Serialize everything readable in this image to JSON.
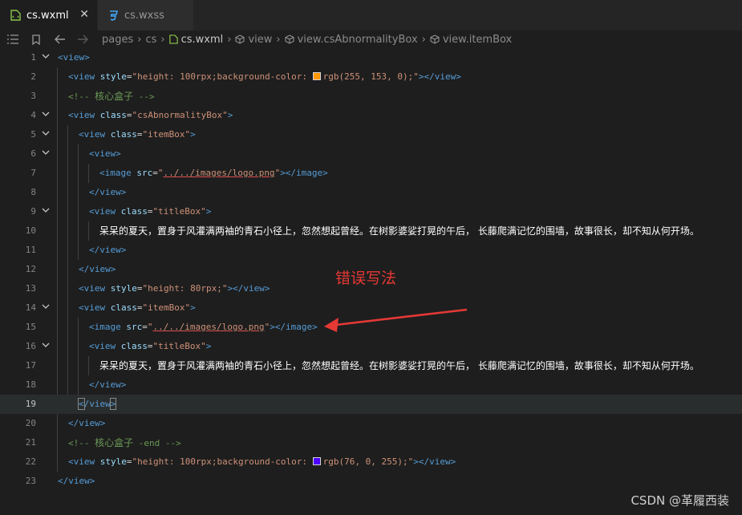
{
  "tabs": [
    {
      "label": "cs.wxml",
      "icon": "wxml-file-icon",
      "active": true
    },
    {
      "label": "cs.wxss",
      "icon": "css-file-icon",
      "active": false
    }
  ],
  "breadcrumb": {
    "items": [
      "pages",
      "cs",
      "cs.wxml",
      "view",
      "view.csAbnormalityBox",
      "view.itemBox"
    ]
  },
  "close_glyph": "✕",
  "editor": {
    "active_line": 19,
    "lines": [
      {
        "n": "1",
        "parts": [
          [
            "tag",
            "<view>"
          ]
        ]
      },
      {
        "n": "2",
        "parts": [
          [
            "tag",
            "<view "
          ],
          [
            "attr",
            "style"
          ],
          [
            "pun",
            "="
          ],
          [
            "str",
            "\"height: 100rpx;background-color: "
          ],
          [
            "swatch",
            "#ff9900"
          ],
          [
            "str",
            "rgb(255, 153, 0);\""
          ],
          [
            "tag",
            "></view>"
          ]
        ]
      },
      {
        "n": "3",
        "parts": [
          [
            "cmt",
            "<!-- "
          ],
          [
            "cmtcn",
            "核心盒子"
          ],
          [
            "cmt",
            " -->"
          ]
        ]
      },
      {
        "n": "4",
        "parts": [
          [
            "tag",
            "<view "
          ],
          [
            "attr",
            "class"
          ],
          [
            "pun",
            "="
          ],
          [
            "str",
            "\"csAbnormalityBox\""
          ],
          [
            "tag",
            ">"
          ]
        ]
      },
      {
        "n": "5",
        "parts": [
          [
            "tag",
            "<view "
          ],
          [
            "attr",
            "class"
          ],
          [
            "pun",
            "="
          ],
          [
            "str",
            "\"itemBox\""
          ],
          [
            "tag",
            ">"
          ]
        ]
      },
      {
        "n": "6",
        "parts": [
          [
            "tag",
            "<view>"
          ]
        ]
      },
      {
        "n": "7",
        "parts": [
          [
            "tag",
            "<image "
          ],
          [
            "attr",
            "src"
          ],
          [
            "pun",
            "="
          ],
          [
            "str",
            "\""
          ],
          [
            "path",
            "../../images/logo.png"
          ],
          [
            "str",
            "\""
          ],
          [
            "tag",
            "></image>"
          ]
        ]
      },
      {
        "n": "8",
        "parts": [
          [
            "tag",
            "</view>"
          ]
        ]
      },
      {
        "n": "9",
        "parts": [
          [
            "tag",
            "<view "
          ],
          [
            "attr",
            "class"
          ],
          [
            "pun",
            "="
          ],
          [
            "str",
            "\"titleBox\""
          ],
          [
            "tag",
            ">"
          ]
        ]
      },
      {
        "n": "10",
        "parts": [
          [
            "txtcn",
            "呆呆的夏天，置身于风灌满两袖的青石小径上，忽然想起曾经。在树影婆娑打晃的午后， 长藤爬满记忆的围墙，故事很长，却不知从何开场。"
          ]
        ]
      },
      {
        "n": "11",
        "parts": [
          [
            "tag",
            "</view>"
          ]
        ]
      },
      {
        "n": "12",
        "parts": [
          [
            "tag",
            "</view>"
          ]
        ]
      },
      {
        "n": "13",
        "parts": [
          [
            "tag",
            "<view "
          ],
          [
            "attr",
            "style"
          ],
          [
            "pun",
            "="
          ],
          [
            "str",
            "\"height: 80rpx;\""
          ],
          [
            "tag",
            "></view>"
          ]
        ]
      },
      {
        "n": "14",
        "parts": [
          [
            "tag",
            "<view "
          ],
          [
            "attr",
            "class"
          ],
          [
            "pun",
            "="
          ],
          [
            "str",
            "\"itemBox\""
          ],
          [
            "tag",
            ">"
          ]
        ]
      },
      {
        "n": "15",
        "parts": [
          [
            "tag",
            "<image "
          ],
          [
            "attr",
            "src"
          ],
          [
            "pun",
            "="
          ],
          [
            "str",
            "\""
          ],
          [
            "path",
            "../../images/logo.png"
          ],
          [
            "str",
            "\""
          ],
          [
            "tag",
            "></image>"
          ]
        ]
      },
      {
        "n": "16",
        "parts": [
          [
            "tag",
            "<view "
          ],
          [
            "attr",
            "class"
          ],
          [
            "pun",
            "="
          ],
          [
            "str",
            "\"titleBox\""
          ],
          [
            "tag",
            ">"
          ]
        ]
      },
      {
        "n": "17",
        "parts": [
          [
            "txtcn",
            "呆呆的夏天，置身于风灌满两袖的青石小径上，忽然想起曾经。在树影婆娑打晃的午后， 长藤爬满记忆的围墙，故事很长，却不知从何开场。"
          ]
        ]
      },
      {
        "n": "18",
        "parts": [
          [
            "tag",
            "</view>"
          ]
        ]
      },
      {
        "n": "19",
        "parts": [
          [
            "tagbrk",
            "<"
          ],
          [
            "tag",
            "/view"
          ],
          [
            "tagbrk",
            ">"
          ]
        ]
      },
      {
        "n": "20",
        "parts": [
          [
            "tag",
            "</view>"
          ]
        ]
      },
      {
        "n": "21",
        "parts": [
          [
            "cmt",
            "<!-- "
          ],
          [
            "cmtcn",
            "核心盒子"
          ],
          [
            "cmt",
            " -end -->"
          ]
        ]
      },
      {
        "n": "22",
        "parts": [
          [
            "tag",
            "<view "
          ],
          [
            "attr",
            "style"
          ],
          [
            "pun",
            "="
          ],
          [
            "str",
            "\"height: 100rpx;background-color: "
          ],
          [
            "swatch",
            "#4c00ff"
          ],
          [
            "str",
            "rgb(76, 0, 255);\""
          ],
          [
            "tag",
            "></view>"
          ]
        ]
      },
      {
        "n": "23",
        "parts": [
          [
            "tag",
            "</view>"
          ]
        ]
      }
    ]
  },
  "annotation": {
    "label": "错误写法",
    "color": "#e53935"
  },
  "watermark": "CSDN @革履西装"
}
